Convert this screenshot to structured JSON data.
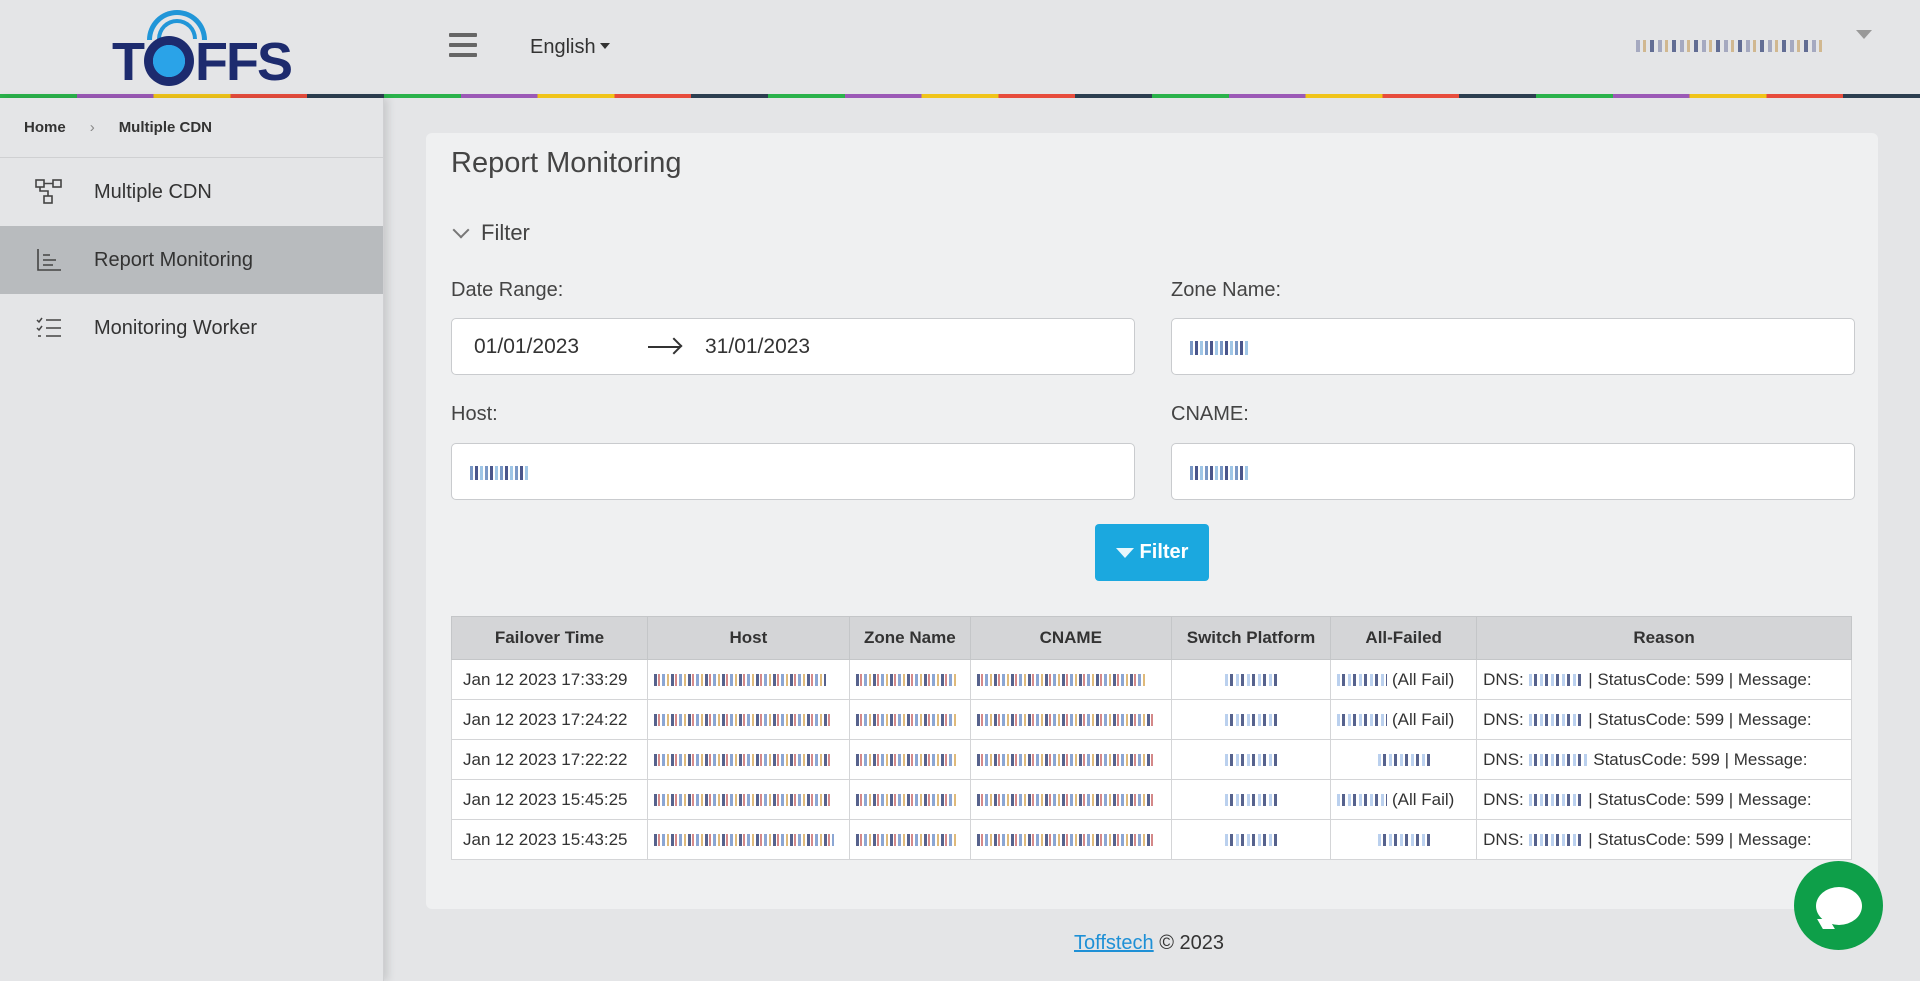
{
  "header": {
    "logo_text": "TOFFS",
    "language": "English"
  },
  "breadcrumb": {
    "home": "Home",
    "current": "Multiple CDN"
  },
  "sidebar": {
    "items": [
      {
        "label": "Multiple CDN",
        "icon": "network-icon",
        "active": false
      },
      {
        "label": "Report Monitoring",
        "icon": "bar-chart-icon",
        "active": true
      },
      {
        "label": "Monitoring Worker",
        "icon": "checklist-icon",
        "active": false
      }
    ]
  },
  "main": {
    "title": "Report Monitoring",
    "filter_toggle": "Filter",
    "date_range_label": "Date Range:",
    "date_from": "01/01/2023",
    "date_to": "31/01/2023",
    "zone_name_label": "Zone Name:",
    "host_label": "Host:",
    "cname_label": "CNAME:",
    "filter_button": "Filter"
  },
  "table": {
    "headers": [
      "Failover Time",
      "Host",
      "Zone Name",
      "CNAME",
      "Switch Platform",
      "All-Failed",
      "Reason"
    ],
    "rows": [
      {
        "time": "Jan 12 2023 17:33:29",
        "all_failed": "(All Fail)",
        "reason_prefix": "DNS:",
        "reason_suffix": "| StatusCode: 599 | Message:"
      },
      {
        "time": "Jan 12 2023 17:24:22",
        "all_failed": "(All Fail)",
        "reason_prefix": "DNS:",
        "reason_suffix": "| StatusCode: 599 | Message:"
      },
      {
        "time": "Jan 12 2023 17:22:22",
        "all_failed": "",
        "reason_prefix": "DNS:",
        "reason_suffix": "StatusCode: 599 | Message:"
      },
      {
        "time": "Jan 12 2023 15:45:25",
        "all_failed": "(All Fail)",
        "reason_prefix": "DNS:",
        "reason_suffix": "| StatusCode: 599 | Message:"
      },
      {
        "time": "Jan 12 2023 15:43:25",
        "all_failed": "",
        "reason_prefix": "DNS:",
        "reason_suffix": "| StatusCode: 599 | Message:"
      }
    ]
  },
  "footer": {
    "link": "Toffstech",
    "copyright": "© 2023"
  },
  "colors": {
    "accent": "#1ba8df",
    "brand_navy": "#1d2b6e",
    "chat_green": "#0e9f49",
    "active_nav": "#b8bbbe"
  }
}
